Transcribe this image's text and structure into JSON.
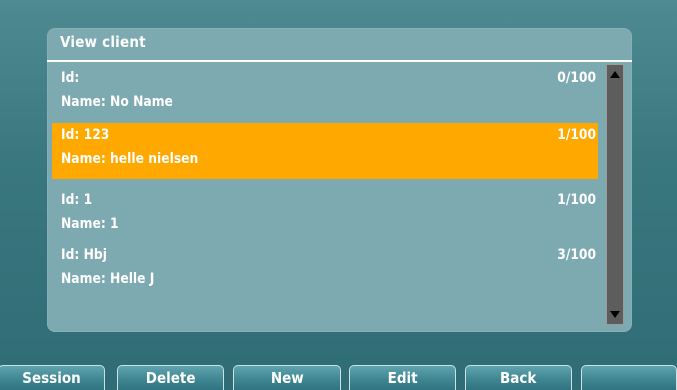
{
  "panel": {
    "title": "View client"
  },
  "clients": [
    {
      "id": "Id:",
      "name": "Name: No Name",
      "count": "0/100",
      "selected": false
    },
    {
      "id": "Id: 123",
      "name": "Name: helle nielsen",
      "count": "1/100",
      "selected": true
    },
    {
      "id": "Id: 1",
      "name": "Name: 1",
      "count": "1/100",
      "selected": false
    },
    {
      "id": "Id: Hbj",
      "name": "Name: Helle J",
      "count": "3/100",
      "selected": false
    }
  ],
  "softkeys": {
    "session": "Session",
    "delete": "Delete",
    "new": "New",
    "edit": "Edit",
    "back": "Back",
    "blank": ""
  },
  "colors": {
    "background": "#3a7880",
    "panel": "#7da9b0",
    "selection": "#ffa800",
    "scrollbar": "#5d5d5d"
  },
  "icons": {
    "scroll_up": "triangle-up-icon",
    "scroll_down": "triangle-down-icon"
  }
}
